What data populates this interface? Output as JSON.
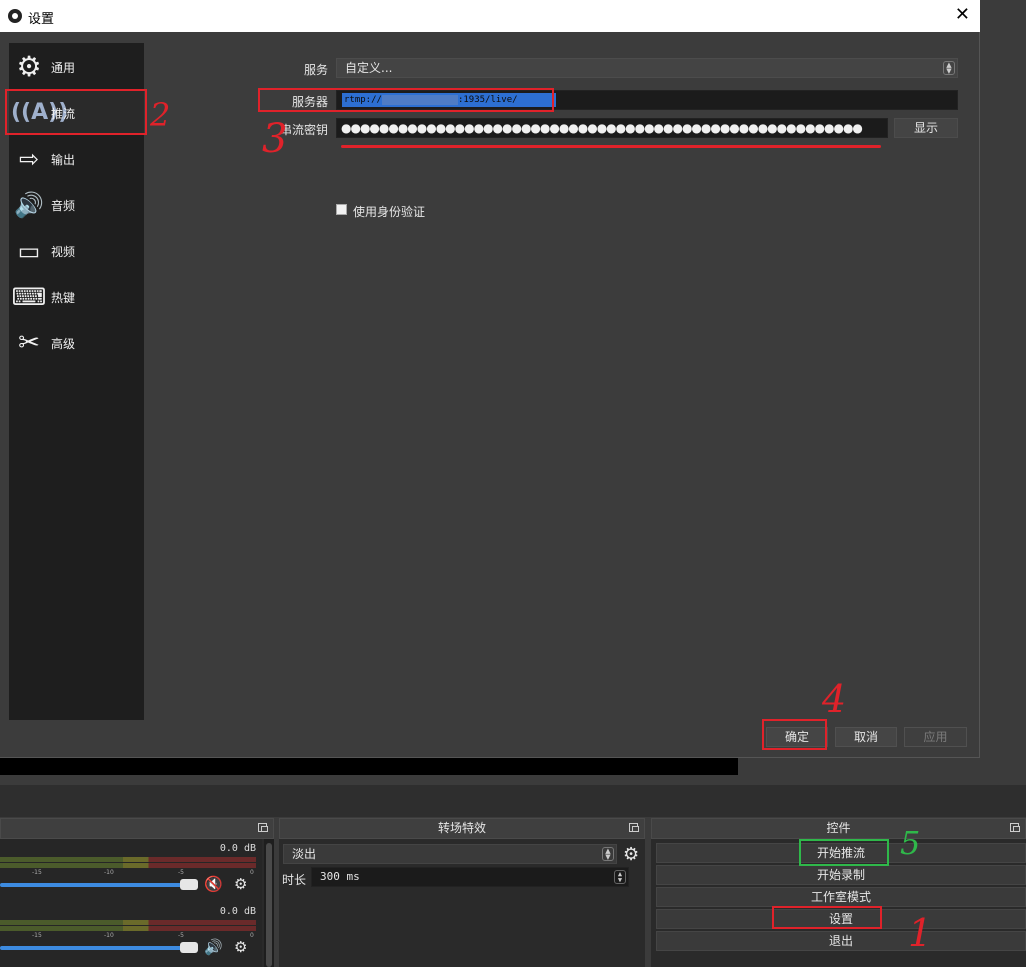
{
  "dialog": {
    "title": "设置",
    "close_label": "✕"
  },
  "sidebar": {
    "items": [
      {
        "label": "通用",
        "icon": "gear-icon"
      },
      {
        "label": "推流",
        "icon": "broadcast-antenna-icon"
      },
      {
        "label": "输出",
        "icon": "output-monitor-icon"
      },
      {
        "label": "音频",
        "icon": "speaker-icon"
      },
      {
        "label": "视频",
        "icon": "monitor-icon"
      },
      {
        "label": "热键",
        "icon": "keyboard-icon"
      },
      {
        "label": "高级",
        "icon": "tools-icon"
      }
    ],
    "active": "推流"
  },
  "stream": {
    "service_label": "服务",
    "service_value": "自定义...",
    "server_label": "服务器",
    "server_value_prefix": "rtmp://",
    "server_value_suffix": ":1935/live/",
    "key_label": "串流密钥",
    "key_value": "●●●●●●●●●●●●●●●●●●●●●●●●●●●●●●●●●●●●●●●●●●●●●●●●●●●●●●●",
    "show_button": "显示",
    "auth_checkbox_label": "使用身份验证"
  },
  "dialog_buttons": {
    "ok": "确定",
    "cancel": "取消",
    "apply": "应用"
  },
  "mixer": {
    "channels": [
      {
        "db": "0.0 dB",
        "muted": true
      },
      {
        "db": "0.0 dB",
        "muted": false
      }
    ],
    "tick_labels": [
      "-15",
      "-10",
      "-5",
      "0"
    ]
  },
  "transitions": {
    "title": "转场特效",
    "selected": "淡出",
    "duration_label": "时长",
    "duration_value": "300 ms"
  },
  "controls": {
    "title": "控件",
    "buttons": [
      "开始推流",
      "开始录制",
      "工作室模式",
      "设置",
      "退出"
    ]
  },
  "annotations": {
    "numbers": [
      "1",
      "2",
      "3",
      "4",
      "5"
    ],
    "colors": {
      "red": "#e0222a",
      "green": "#2fb84a"
    }
  }
}
